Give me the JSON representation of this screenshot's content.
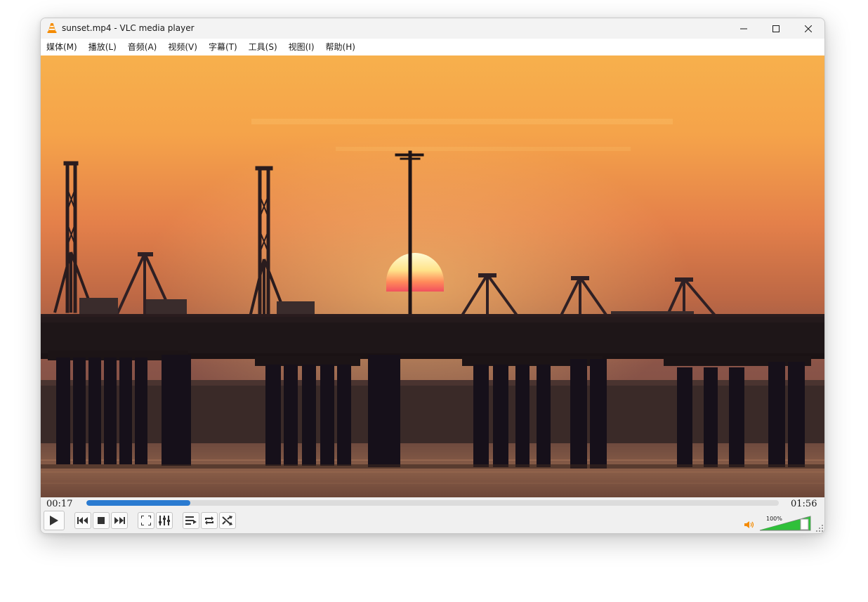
{
  "window": {
    "title": "sunset.mp4 - VLC media player",
    "app_icon": "vlc-cone-icon"
  },
  "menu": [
    {
      "label": "媒体(M)"
    },
    {
      "label": "播放(L)"
    },
    {
      "label": "音频(A)"
    },
    {
      "label": "视频(V)"
    },
    {
      "label": "字幕(T)"
    },
    {
      "label": "工具(S)"
    },
    {
      "label": "视图(I)"
    },
    {
      "label": "帮助(H)"
    }
  ],
  "video": {
    "scene": "sunset over harbor bridge with cranes"
  },
  "playback": {
    "elapsed": "00:17",
    "total": "01:56",
    "progress": 0.15
  },
  "controls": {
    "play": "play-icon",
    "previous": "previous-icon",
    "stop": "stop-icon",
    "next": "next-icon",
    "fullscreen": "fullscreen-icon",
    "extended_settings": "equalizer-icon",
    "playlist": "playlist-icon",
    "loop": "loop-icon",
    "shuffle": "shuffle-icon"
  },
  "volume": {
    "label": "100%",
    "level": 1.0
  },
  "colors": {
    "seek_fill": "#2a7bd1",
    "volume_fill": "#2fc03a",
    "vlc_orange": "#f48b00"
  }
}
